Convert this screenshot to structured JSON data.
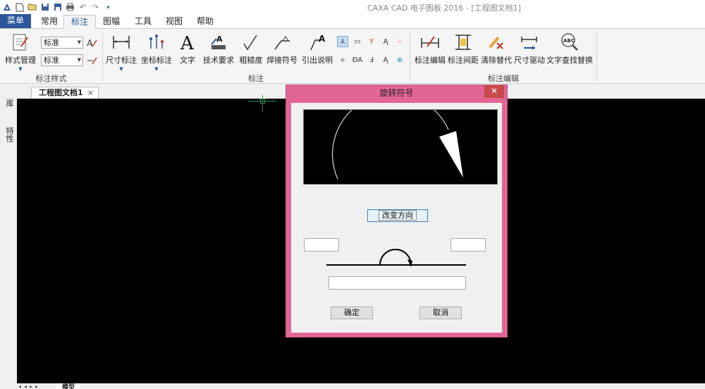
{
  "app": {
    "title": "CAXA CAD 电子图板 2016 - [工程图文档1]"
  },
  "quick_access": [
    "new-icon",
    "open-icon",
    "save-icon",
    "save-as-icon",
    "print-icon",
    "undo-icon",
    "redo-icon",
    "customize-icon"
  ],
  "tabs": [
    {
      "label": "菜单"
    },
    {
      "label": "常用"
    },
    {
      "label": "标注"
    },
    {
      "label": "图幅"
    },
    {
      "label": "工具"
    },
    {
      "label": "视图"
    },
    {
      "label": "帮助"
    }
  ],
  "ribbon": {
    "style_group": {
      "label": "标注样式",
      "style_manage": "样式管理",
      "combo1": "标准",
      "combo2": "标准"
    },
    "annotate_group": {
      "label": "标注",
      "buttons": [
        "尺寸标注",
        "坐标标注",
        "文字",
        "技术要求",
        "粗糙度",
        "焊接符号",
        "引出说明"
      ]
    },
    "edit_group": {
      "label": "标注编辑",
      "buttons": [
        "标注编辑",
        "标注间距",
        "清除替代",
        "尺寸驱动",
        "文字查找替换"
      ]
    }
  },
  "document": {
    "tab": "工程图文档1",
    "side_items": [
      "图库",
      "特性"
    ],
    "model_tab": "模型"
  },
  "dialog": {
    "title": "旋转符号",
    "change_dir": "改变方向",
    "ok": "确定",
    "cancel": "取消",
    "left_field": "",
    "right_field": "",
    "text_field": ""
  }
}
